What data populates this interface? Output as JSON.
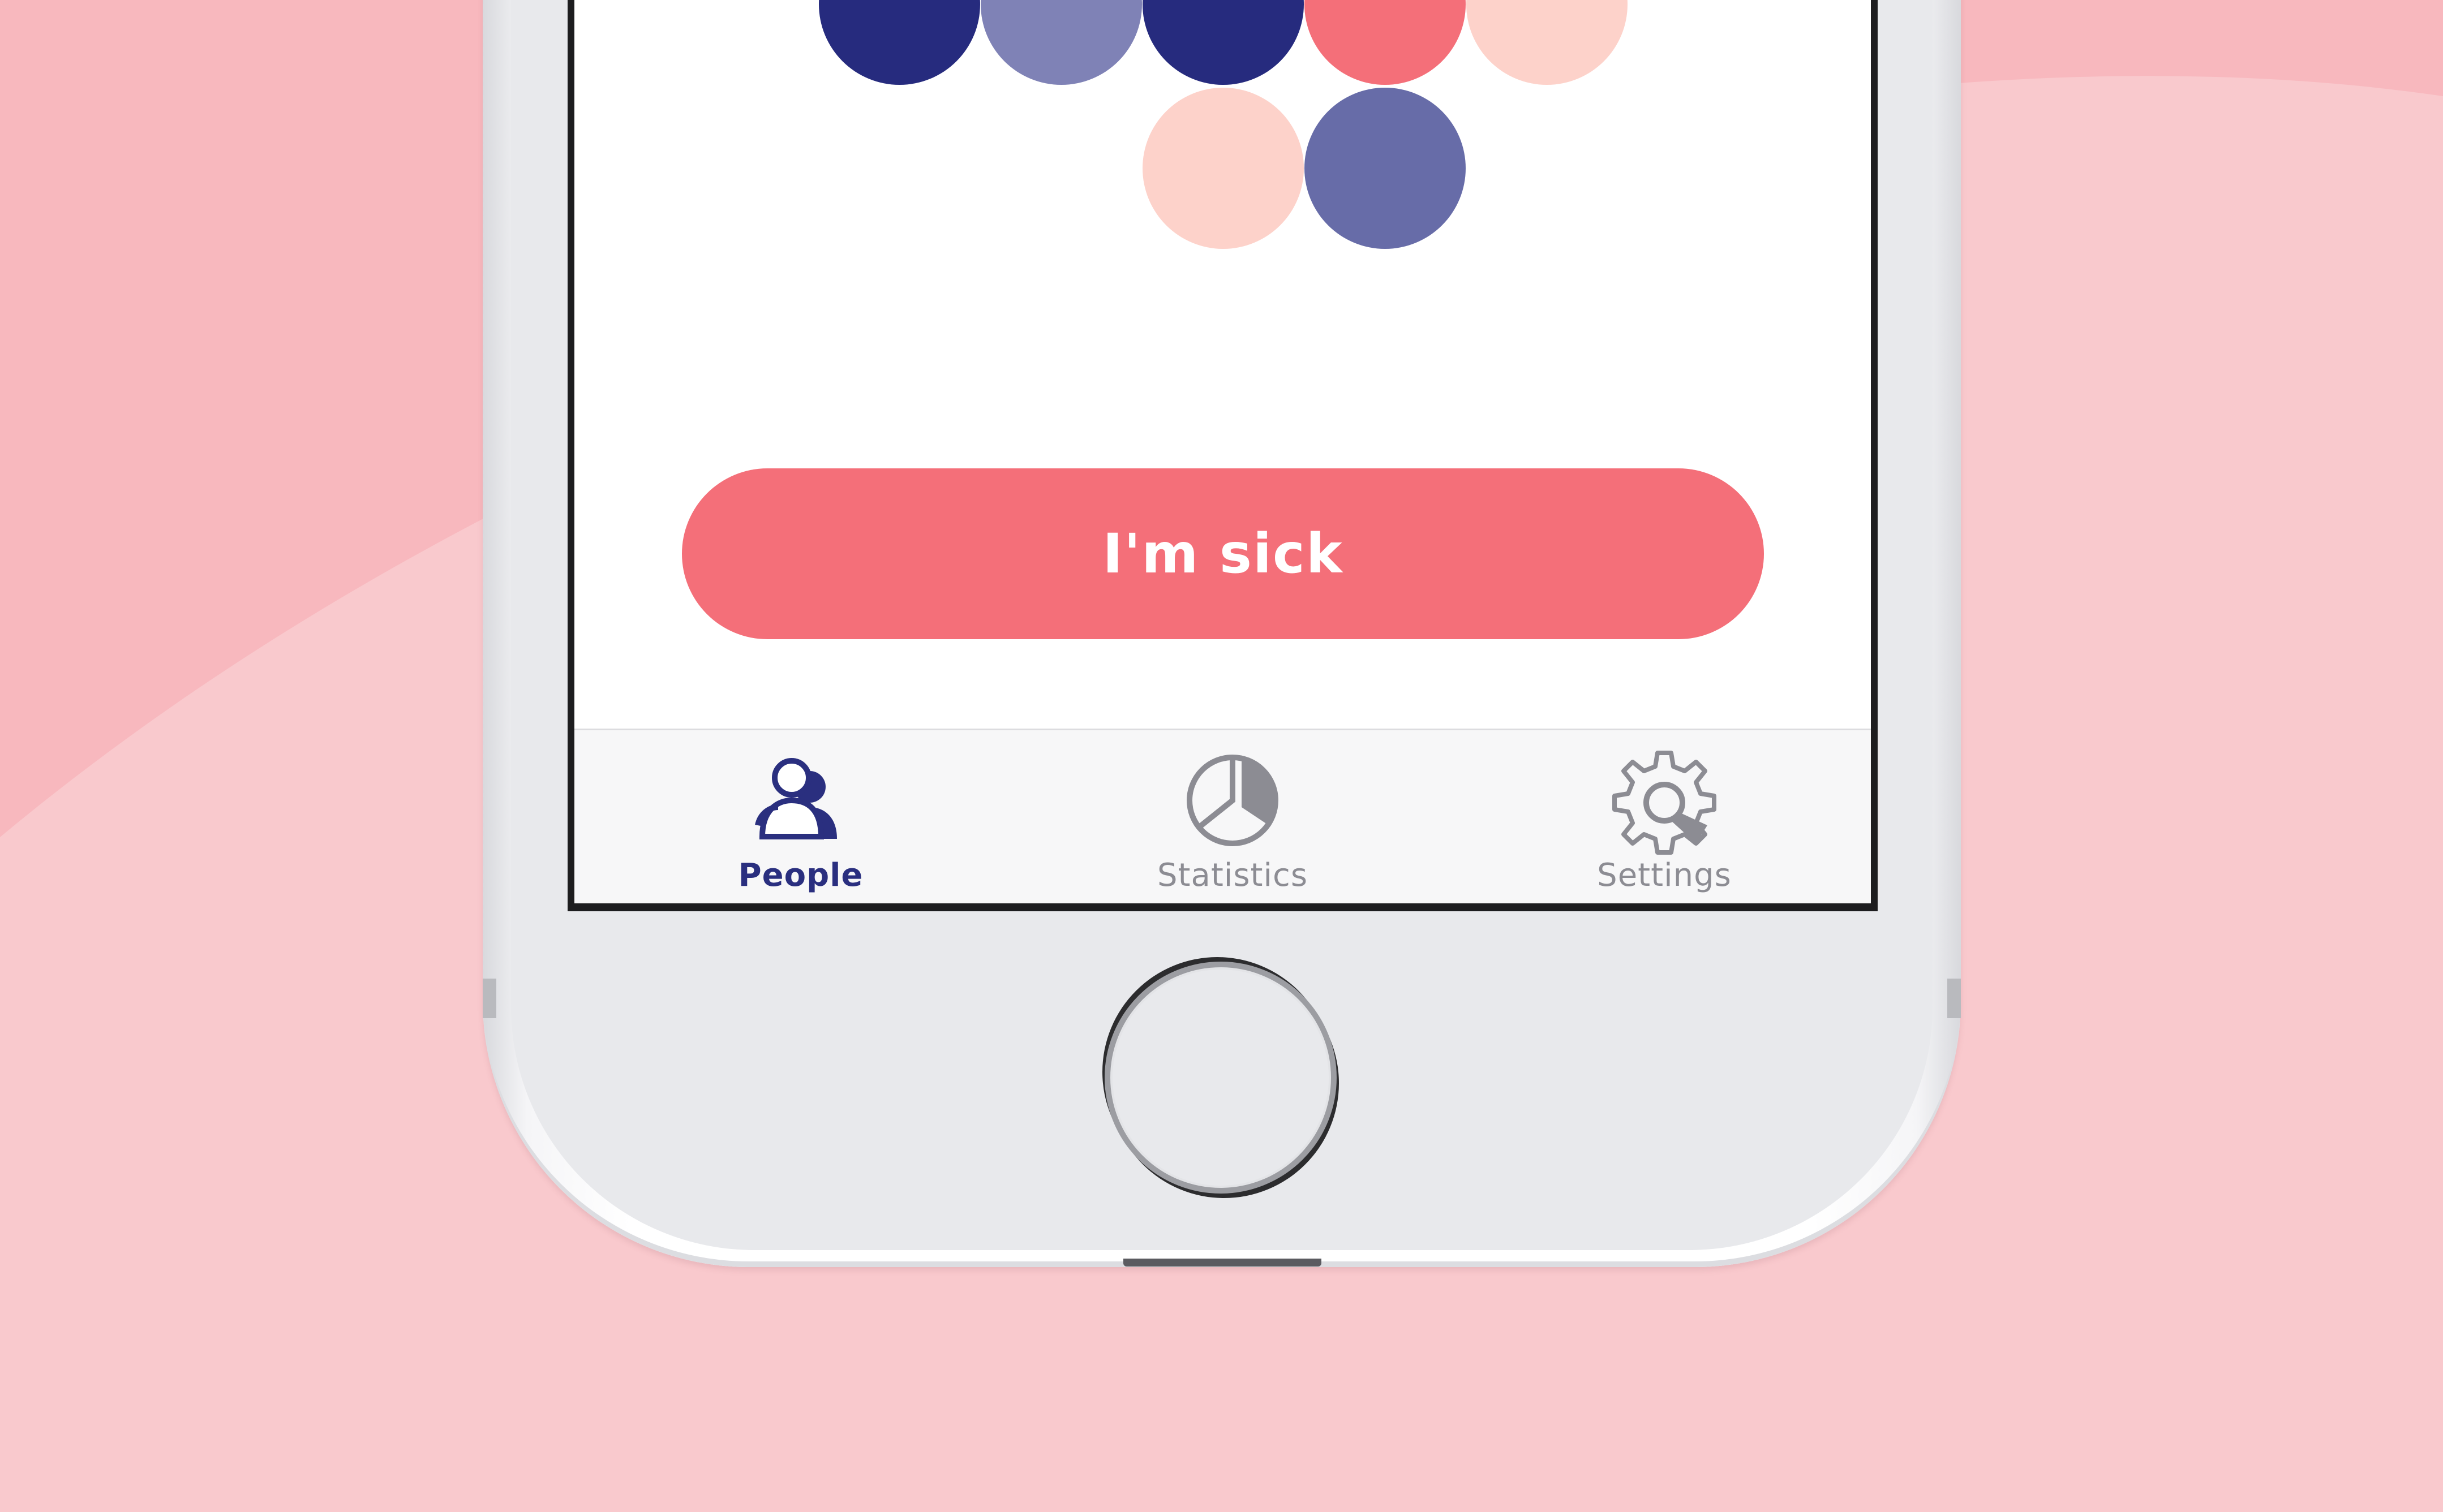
{
  "colors": {
    "background": "#f9c9cd",
    "background_shape": "#f8b8be",
    "accent": "#f46f79",
    "navy": "#262b7e",
    "lavender": "#7f82b6",
    "slate_blue": "#676ca8",
    "coral": "#f46f79",
    "peach": "#fdd2ca",
    "tab_active": "#2a2f7f",
    "tab_inactive": "#8c8c93"
  },
  "people_dots": [
    {
      "color": "#262b7e",
      "name": "person-dot-navy"
    },
    {
      "color": "#7f82b6",
      "name": "person-dot-lavender"
    },
    {
      "color": "#262b7e",
      "name": "person-dot-navy"
    },
    {
      "color": "#f46f79",
      "name": "person-dot-coral"
    },
    {
      "color": "#fdd2ca",
      "name": "person-dot-peach"
    },
    {
      "color": "#fdd2ca",
      "name": "person-dot-peach"
    },
    {
      "color": "#676ca8",
      "name": "person-dot-slate"
    }
  ],
  "main": {
    "sick_button_label": "I'm sick"
  },
  "tabbar": {
    "tabs": [
      {
        "label": "People",
        "icon": "people-icon",
        "active": true
      },
      {
        "label": "Statistics",
        "icon": "pie-chart-icon",
        "active": false
      },
      {
        "label": "Settings",
        "icon": "gear-icon",
        "active": false
      }
    ]
  }
}
